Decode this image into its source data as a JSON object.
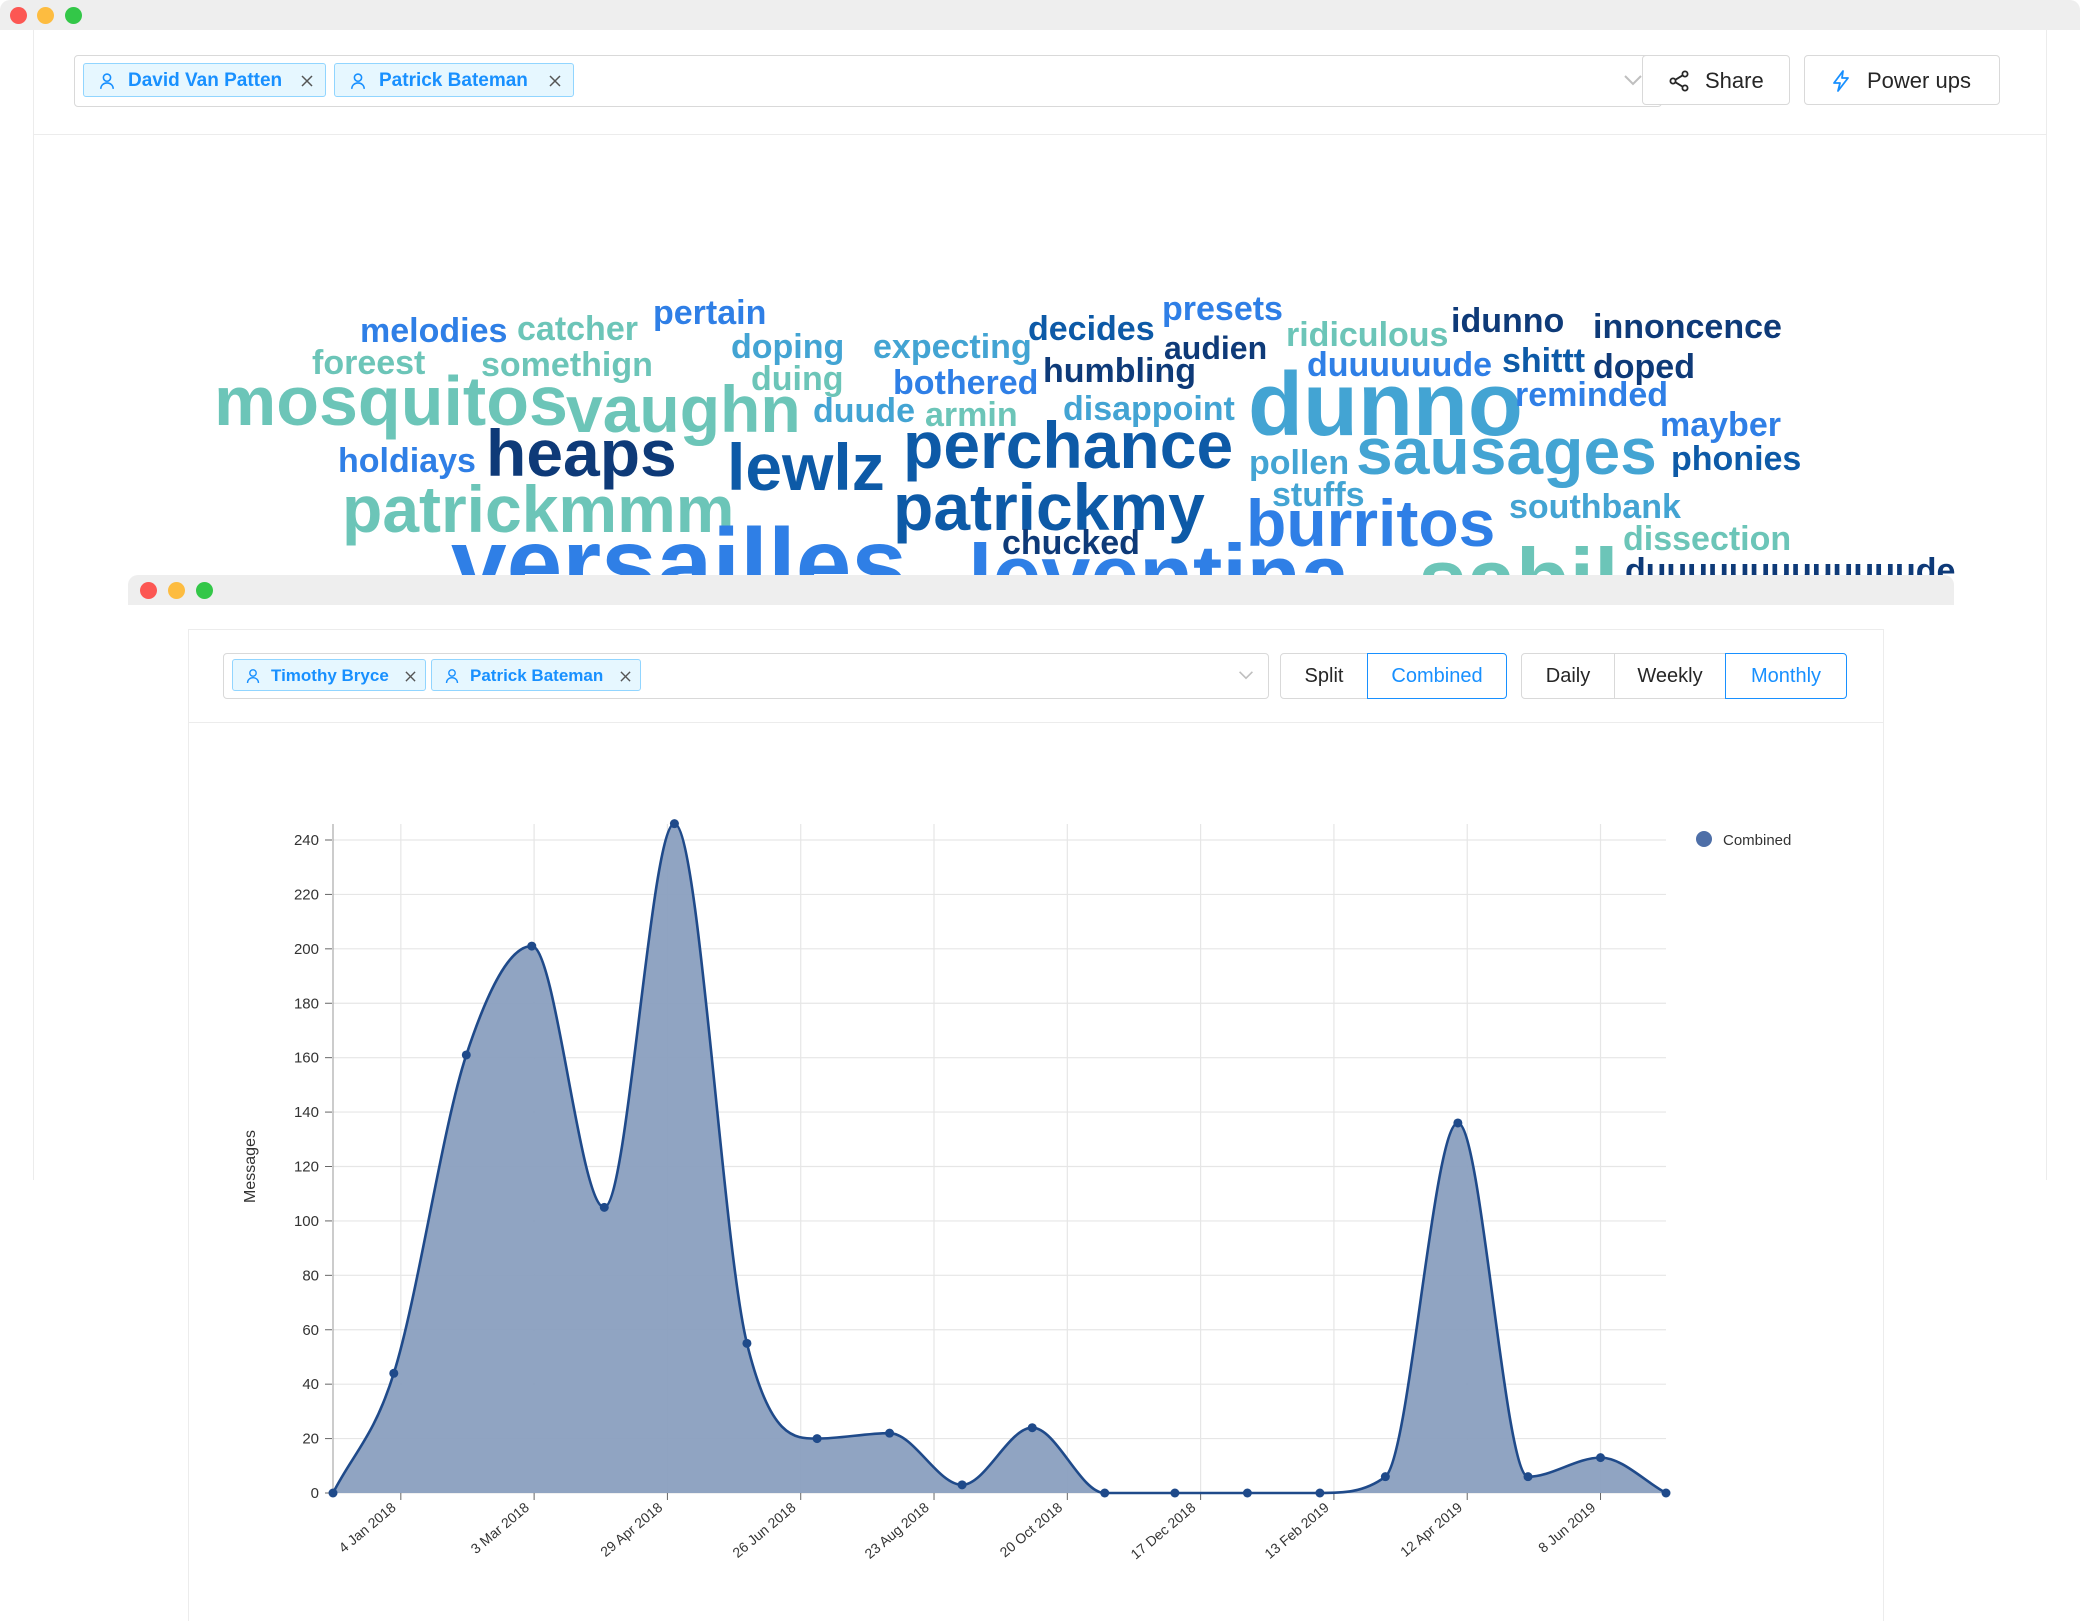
{
  "window_top": {
    "select_tags": [
      "David Van Patten",
      "Patrick Bateman"
    ],
    "share_label": "Share",
    "powerups_label": "Power ups"
  },
  "word_cloud": [
    {
      "text": "melodies",
      "color": "#2f7fe6"
    },
    {
      "text": "catcher",
      "color": "#6cc5b8"
    },
    {
      "text": "pertain",
      "color": "#2f7fe6"
    },
    {
      "text": "doping",
      "color": "#43a4d3"
    },
    {
      "text": "expecting",
      "color": "#43a4d3"
    },
    {
      "text": "decides",
      "color": "#0d5aa7"
    },
    {
      "text": "presets",
      "color": "#2f7fe6"
    },
    {
      "text": "audien",
      "color": "#0e3a78"
    },
    {
      "text": "ridiculous",
      "color": "#6cc5b8"
    },
    {
      "text": "idunno",
      "color": "#0e3a78"
    },
    {
      "text": "innoncence",
      "color": "#0e3a78"
    },
    {
      "text": "foreest",
      "color": "#6cc5b8"
    },
    {
      "text": "somethign",
      "color": "#6cc5b8"
    },
    {
      "text": "duing",
      "color": "#6cc5b8"
    },
    {
      "text": "humbling",
      "color": "#0e3a78"
    },
    {
      "text": "duuuuuude",
      "color": "#2f7fe6"
    },
    {
      "text": "shittt",
      "color": "#0d5aa7"
    },
    {
      "text": "doped",
      "color": "#0e3a78"
    },
    {
      "text": "mosquitos",
      "color": "#6cc5b8"
    },
    {
      "text": "vaughn",
      "color": "#6cc5b8"
    },
    {
      "text": "bothered",
      "color": "#2f7fe6"
    },
    {
      "text": "dunno",
      "color": "#43a4d3"
    },
    {
      "text": "reminded",
      "color": "#2f7fe6"
    },
    {
      "text": "duude",
      "color": "#43a4d3"
    },
    {
      "text": "armin",
      "color": "#6cc5b8"
    },
    {
      "text": "disappoint",
      "color": "#43a4d3"
    },
    {
      "text": "mayber",
      "color": "#2f7fe6"
    },
    {
      "text": "heaps",
      "color": "#0e3a78"
    },
    {
      "text": "perchance",
      "color": "#0d5aa7"
    },
    {
      "text": "sausages",
      "color": "#43a4d3"
    },
    {
      "text": "holdiays",
      "color": "#2f7fe6"
    },
    {
      "text": "lewlz",
      "color": "#0d5aa7"
    },
    {
      "text": "pollen",
      "color": "#43a4d3"
    },
    {
      "text": "phonies",
      "color": "#0d5aa7"
    },
    {
      "text": "patrickmmm",
      "color": "#6cc5b8"
    },
    {
      "text": "patrickmy",
      "color": "#0d5aa7"
    },
    {
      "text": "stuffs",
      "color": "#43a4d3"
    },
    {
      "text": "southbank",
      "color": "#43a4d3"
    },
    {
      "text": "burritos",
      "color": "#2f7fe6"
    },
    {
      "text": "chucked",
      "color": "#0e3a78"
    },
    {
      "text": "dissection",
      "color": "#6cc5b8"
    },
    {
      "text": "versailles",
      "color": "#2f7fe6"
    },
    {
      "text": "leventina",
      "color": "#2f7fe6"
    },
    {
      "text": "sabil",
      "color": "#6cc5b8"
    },
    {
      "text": "duuuuuuuuuuuuude",
      "color": "#0e3a78"
    }
  ],
  "window_bottom": {
    "select_tags": [
      "Timothy Bryce",
      "Patrick Bateman"
    ],
    "view_modes": [
      {
        "label": "Split",
        "active": false
      },
      {
        "label": "Combined",
        "active": true
      }
    ],
    "intervals": [
      {
        "label": "Daily",
        "active": false
      },
      {
        "label": "Weekly",
        "active": false
      },
      {
        "label": "Monthly",
        "active": true
      }
    ]
  },
  "chart_data": {
    "type": "area",
    "ylabel": "Messages",
    "xlabel": "",
    "ylim": [
      0,
      240
    ],
    "yticks": [
      0,
      20,
      40,
      60,
      80,
      100,
      120,
      140,
      160,
      180,
      200,
      220,
      240
    ],
    "xtick_labels": [
      "4 Jan 2018",
      "3 Mar 2018",
      "29 Apr 2018",
      "26 Jun 2018",
      "23 Aug 2018",
      "20 Oct 2018",
      "17 Dec 2018",
      "13 Feb 2019",
      "12 Apr 2019",
      "8 Jun 2019"
    ],
    "grid": true,
    "legend": {
      "position": "top-right",
      "entries": [
        "Combined"
      ]
    },
    "series": [
      {
        "name": "Combined",
        "color": "#1f4a8a",
        "fill": "#8a9fbf",
        "points": [
          {
            "x": "2017-12-06",
            "y": 0
          },
          {
            "x": "2018-01-01",
            "y": 44
          },
          {
            "x": "2018-02-01",
            "y": 161
          },
          {
            "x": "2018-03-01",
            "y": 201
          },
          {
            "x": "2018-04-01",
            "y": 105
          },
          {
            "x": "2018-05-01",
            "y": 246
          },
          {
            "x": "2018-06-01",
            "y": 55
          },
          {
            "x": "2018-07-01",
            "y": 20
          },
          {
            "x": "2018-08-01",
            "y": 22
          },
          {
            "x": "2018-09-01",
            "y": 3
          },
          {
            "x": "2018-10-01",
            "y": 24
          },
          {
            "x": "2018-11-01",
            "y": 0
          },
          {
            "x": "2018-12-01",
            "y": 0
          },
          {
            "x": "2019-01-01",
            "y": 0
          },
          {
            "x": "2019-02-01",
            "y": 0
          },
          {
            "x": "2019-03-01",
            "y": 6
          },
          {
            "x": "2019-04-01",
            "y": 136
          },
          {
            "x": "2019-05-01",
            "y": 6
          },
          {
            "x": "2019-06-01",
            "y": 13
          },
          {
            "x": "2019-06-29",
            "y": 0
          }
        ]
      }
    ]
  }
}
